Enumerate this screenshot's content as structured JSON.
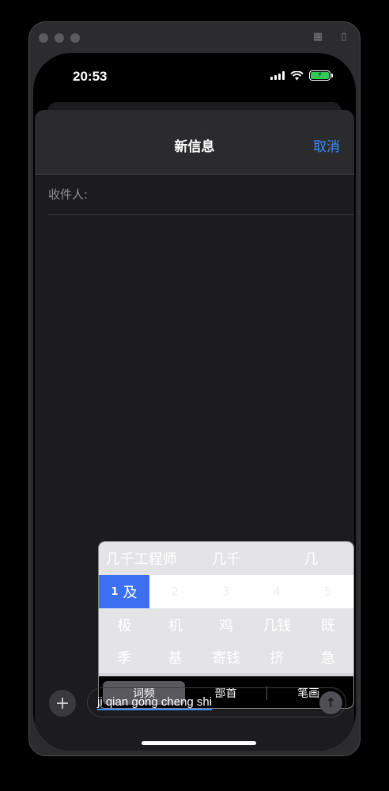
{
  "status": {
    "time": "20:53"
  },
  "nav": {
    "title": "新信息",
    "cancel": "取消"
  },
  "recipient": {
    "label": "收件人:"
  },
  "ime": {
    "top_candidates": [
      "几千工程师",
      "几千",
      "几"
    ],
    "selected": {
      "number": "1",
      "char": "及"
    },
    "numbers": [
      "2",
      "3",
      "4",
      "5"
    ],
    "row1": [
      "极",
      "机",
      "鸡",
      "几钱",
      "既"
    ],
    "row2": [
      "季",
      "基",
      "寄钱",
      "挤",
      "急"
    ],
    "tabs": [
      "词频",
      "部首",
      "笔画"
    ]
  },
  "input": {
    "text": "ji qian gong cheng shi"
  },
  "colors": {
    "accent": "#3a8dff",
    "ime_selected": "#3d6ff2",
    "battery": "#34c759"
  }
}
